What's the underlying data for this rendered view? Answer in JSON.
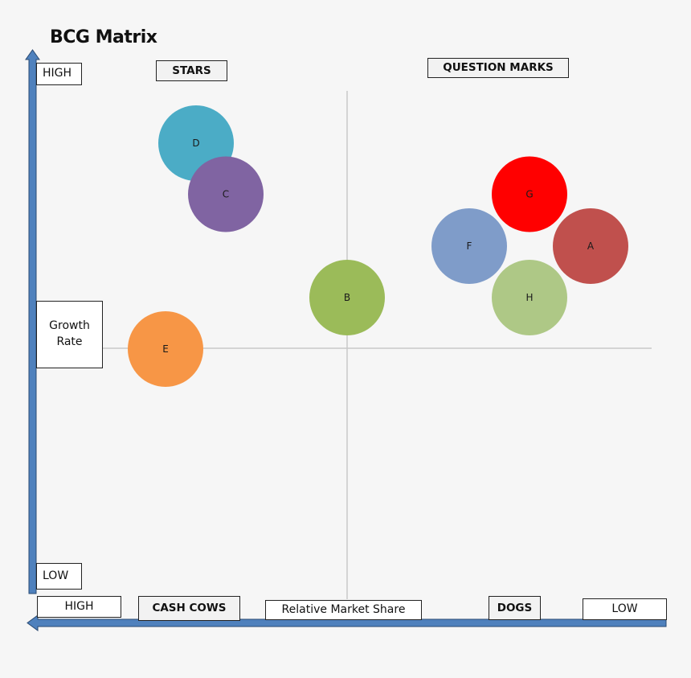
{
  "chart_data": {
    "type": "scatter",
    "subtype": "bubble",
    "title": "BCG Matrix",
    "xlabel": "Relative Market Share",
    "ylabel": "Growth Rate",
    "x_axis": {
      "left_label": "HIGH",
      "right_label": "LOW",
      "direction": "decreasing-left-to-right",
      "range": [
        0,
        100
      ]
    },
    "y_axis": {
      "top_label": "HIGH",
      "bottom_label": "LOW",
      "range": [
        0,
        100
      ]
    },
    "quadrant_labels": {
      "top_left": "STARS",
      "top_right": "QUESTION MARKS",
      "bottom_left": "CASH COWS",
      "bottom_right": "DOGS"
    },
    "divider": {
      "x": 50,
      "y": 50
    },
    "grid": false,
    "legend": "none",
    "points": [
      {
        "label": "D",
        "x": 15,
        "y": 90,
        "size": 1,
        "color": "#4bacc6"
      },
      {
        "label": "C",
        "x": 20,
        "y": 80,
        "size": 1,
        "color": "#8064a2"
      },
      {
        "label": "G",
        "x": 67,
        "y": 80,
        "size": 1,
        "color": "#ff0000"
      },
      {
        "label": "F",
        "x": 58,
        "y": 70,
        "size": 1,
        "color": "#7f9cc9"
      },
      {
        "label": "A",
        "x": 77,
        "y": 70,
        "size": 1,
        "color": "#c0504d"
      },
      {
        "label": "B",
        "x": 40,
        "y": 60,
        "size": 1,
        "color": "#9bbb59"
      },
      {
        "label": "H",
        "x": 67,
        "y": 60,
        "size": 1,
        "color": "#aec886"
      },
      {
        "label": "E",
        "x": 10,
        "y": 50,
        "size": 1,
        "color": "#f79646"
      }
    ]
  },
  "colors": {
    "axis": "#4f81bd",
    "axis_outline": "#2a4a72",
    "divider": "#c8c8c8",
    "background": "#f6f6f6"
  }
}
